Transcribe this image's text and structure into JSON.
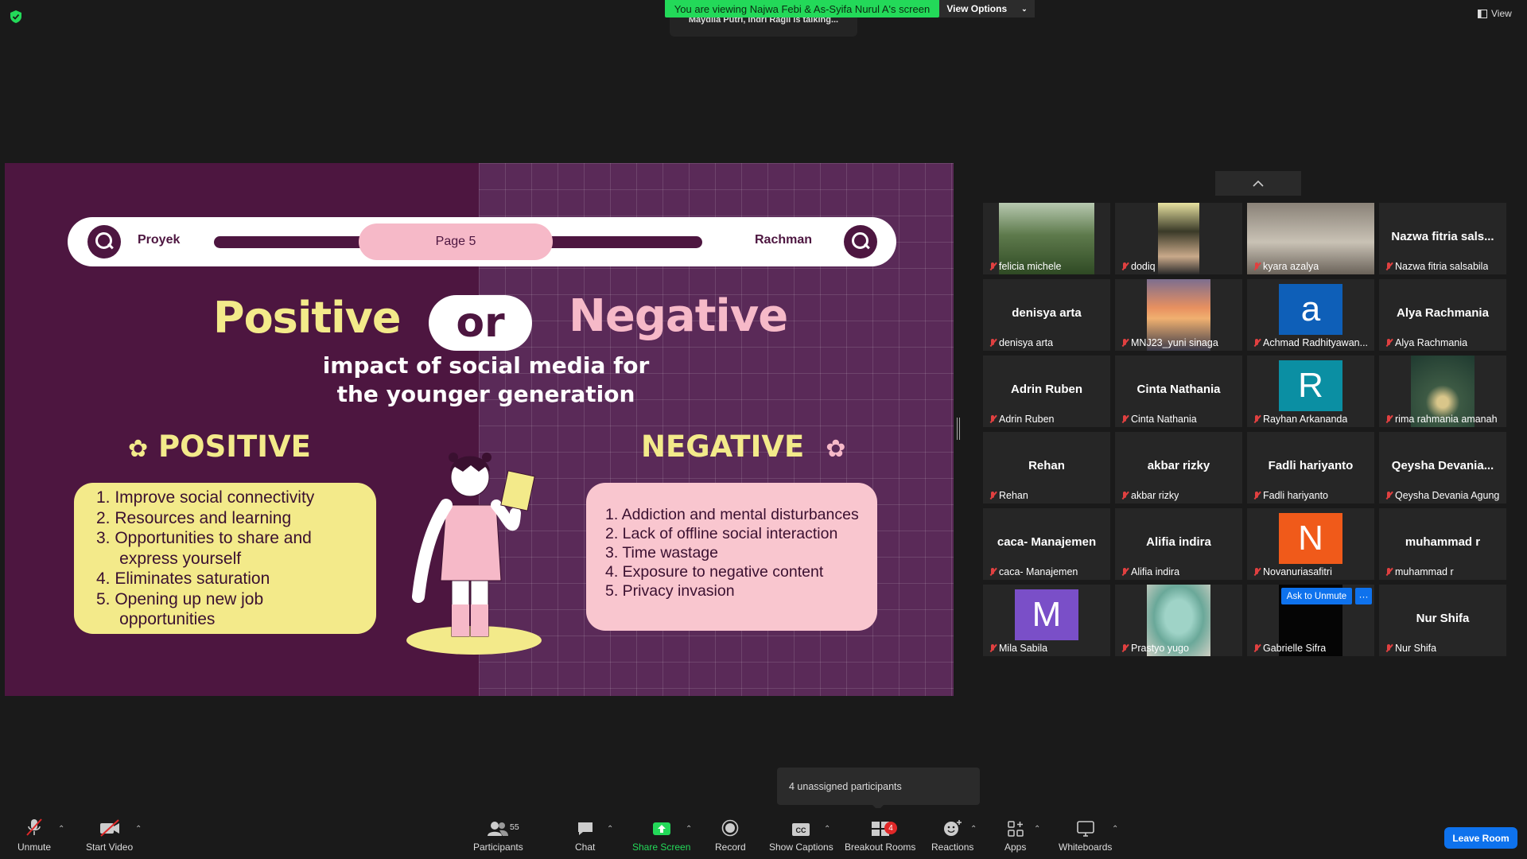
{
  "top": {
    "banner": "You are viewing Najwa Febi & As-Syifa Nurul A's screen",
    "view_options": "View Options",
    "talking": "Maydila Putri, Indri Ragil is talking...",
    "view": "View"
  },
  "slide": {
    "pill_left": "Proyek",
    "page": "Page 5",
    "pill_right": "Rachman",
    "title_positive": "Positive",
    "title_or": "or",
    "title_negative": "Negative",
    "subtitle_1": "impact of social media for",
    "subtitle_2": "the younger generation",
    "positive_heading": "POSITIVE",
    "negative_heading": "NEGATIVE",
    "positive_items": [
      "1. Improve social connectivity",
      "2.  Resources and learning",
      "3.  Opportunities to share and",
      "     express yourself",
      "4.  Eliminates saturation",
      "5.  Opening up new job",
      "     opportunities"
    ],
    "negative_items": [
      "1. Addiction and mental disturbances",
      "2. Lack of offline social interaction",
      "3. Time wastage",
      "4. Exposure to negative content",
      "5. Privacy invasion"
    ]
  },
  "participants": [
    {
      "name": "felicia michele",
      "display": "",
      "photo": "forest"
    },
    {
      "name": "dodiq",
      "display": "",
      "photo": "person"
    },
    {
      "name": "kyara azalya",
      "display": "",
      "photo": "room"
    },
    {
      "name": "Nazwa fitria salsabila",
      "display": "Nazwa fitria sals...",
      "photo": ""
    },
    {
      "name": "denisya arta",
      "display": "denisya arta",
      "photo": ""
    },
    {
      "name": "MNJ23_yuni sinaga",
      "display": "",
      "photo": "sunset"
    },
    {
      "name": "Achmad Radhityawan...",
      "display": "",
      "letter": "a",
      "color": "#0e5fb8"
    },
    {
      "name": "Alya Rachmania",
      "display": "Alya Rachmania",
      "photo": ""
    },
    {
      "name": "Adrin Ruben",
      "display": "Adrin Ruben",
      "photo": ""
    },
    {
      "name": "Cinta Nathania",
      "display": "Cinta Nathania",
      "photo": ""
    },
    {
      "name": "Rayhan Arkananda",
      "display": "",
      "letter": "R",
      "color": "#0b8fa3"
    },
    {
      "name": "rima rahmania amanah",
      "display": "",
      "photo": "plant"
    },
    {
      "name": "Rehan",
      "display": "Rehan",
      "photo": ""
    },
    {
      "name": "akbar rizky",
      "display": "akbar rizky",
      "photo": ""
    },
    {
      "name": "Fadli hariyanto",
      "display": "Fadli hariyanto",
      "photo": ""
    },
    {
      "name": "Qeysha Devania Agung",
      "display": "Qeysha  Devania...",
      "photo": ""
    },
    {
      "name": "caca- Manajemen",
      "display": "caca- Manajemen",
      "photo": ""
    },
    {
      "name": "Alifia indira",
      "display": "Alifia indira",
      "photo": ""
    },
    {
      "name": "Novanuriasafitri",
      "display": "",
      "letter": "N",
      "color": "#f05a1a"
    },
    {
      "name": "muhammad r",
      "display": "muhammad r",
      "photo": ""
    },
    {
      "name": "Mila Sabila",
      "display": "",
      "letter": "M",
      "color": "#7a4fc8"
    },
    {
      "name": "Prastyo yugo",
      "display": "",
      "photo": "squid"
    },
    {
      "name": "Gabrielle Sifra",
      "display": "",
      "photo": "black"
    },
    {
      "name": "Nur Shifa",
      "display": "Nur Shifa",
      "photo": ""
    }
  ],
  "ask_to_unmute": "Ask to Unmute",
  "more": "···",
  "toast": "4 unassigned participants",
  "toolbar": {
    "unmute": "Unmute",
    "start_video": "Start Video",
    "participants": "Participants",
    "participants_count": "55",
    "chat": "Chat",
    "share_screen": "Share Screen",
    "record": "Record",
    "show_captions": "Show Captions",
    "breakout_rooms": "Breakout Rooms",
    "breakout_badge": "4",
    "reactions": "Reactions",
    "apps": "Apps",
    "whiteboards": "Whiteboards",
    "leave": "Leave Room"
  },
  "colors": {
    "banner_green": "#23d959",
    "accent_blue": "#0e72ed",
    "slide_purple": "#4d1640",
    "slide_yellow": "#f3ea8a",
    "slide_pink": "#f6b9c8"
  }
}
